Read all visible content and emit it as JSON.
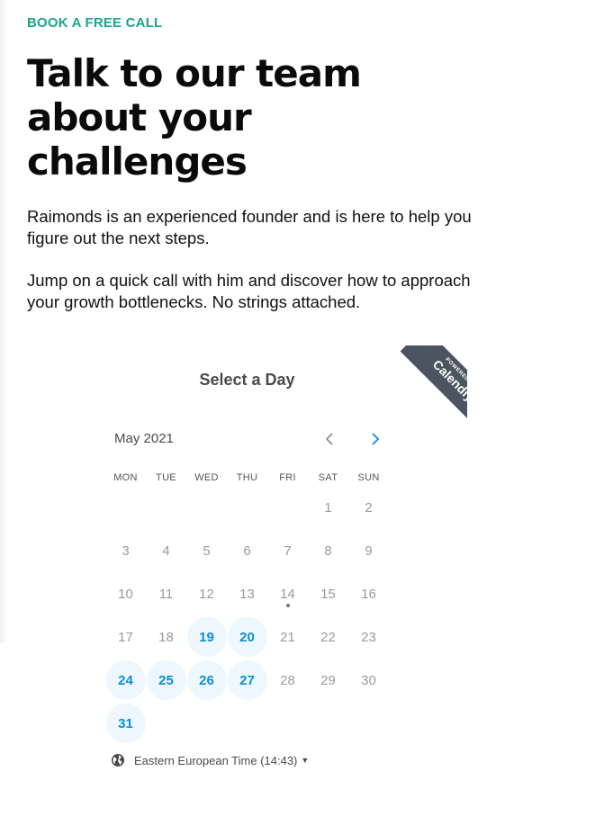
{
  "hero": {
    "eyebrow": "BOOK A FREE CALL",
    "headline": "Talk to our team about your challenges",
    "para1": "Raimonds is an experienced founder and is here to help you figure out the next steps.",
    "para2": "Jump on a quick call with him and discover how to approach your growth bottlenecks. No strings attached."
  },
  "calendar": {
    "ribbon_small": "POWERED BY",
    "ribbon_brand": "Calendly",
    "title": "Select a Day",
    "month": "May 2021",
    "prev_icon": "chevron-left-icon",
    "next_icon": "chevron-right-icon",
    "weekdays": [
      "MON",
      "TUE",
      "WED",
      "THU",
      "FRI",
      "SAT",
      "SUN"
    ],
    "leading_blanks": 5,
    "days": [
      {
        "n": "1",
        "available": false
      },
      {
        "n": "2",
        "available": false
      },
      {
        "n": "3",
        "available": false
      },
      {
        "n": "4",
        "available": false
      },
      {
        "n": "5",
        "available": false
      },
      {
        "n": "6",
        "available": false
      },
      {
        "n": "7",
        "available": false
      },
      {
        "n": "8",
        "available": false
      },
      {
        "n": "9",
        "available": false
      },
      {
        "n": "10",
        "available": false
      },
      {
        "n": "11",
        "available": false
      },
      {
        "n": "12",
        "available": false
      },
      {
        "n": "13",
        "available": false
      },
      {
        "n": "14",
        "available": false,
        "today": true
      },
      {
        "n": "15",
        "available": false
      },
      {
        "n": "16",
        "available": false
      },
      {
        "n": "17",
        "available": false
      },
      {
        "n": "18",
        "available": false
      },
      {
        "n": "19",
        "available": true
      },
      {
        "n": "20",
        "available": true
      },
      {
        "n": "21",
        "available": false
      },
      {
        "n": "22",
        "available": false
      },
      {
        "n": "23",
        "available": false
      },
      {
        "n": "24",
        "available": true
      },
      {
        "n": "25",
        "available": true
      },
      {
        "n": "26",
        "available": true
      },
      {
        "n": "27",
        "available": true
      },
      {
        "n": "28",
        "available": false
      },
      {
        "n": "29",
        "available": false
      },
      {
        "n": "30",
        "available": false
      },
      {
        "n": "31",
        "available": true
      }
    ],
    "timezone": "Eastern European Time (14:43)",
    "timezone_icon": "globe-icon"
  },
  "colors": {
    "accent_green": "#1aa68a",
    "accent_blue": "#0a8ed6",
    "available_bg": "#eef7fd",
    "ribbon_bg": "#4a5560"
  }
}
